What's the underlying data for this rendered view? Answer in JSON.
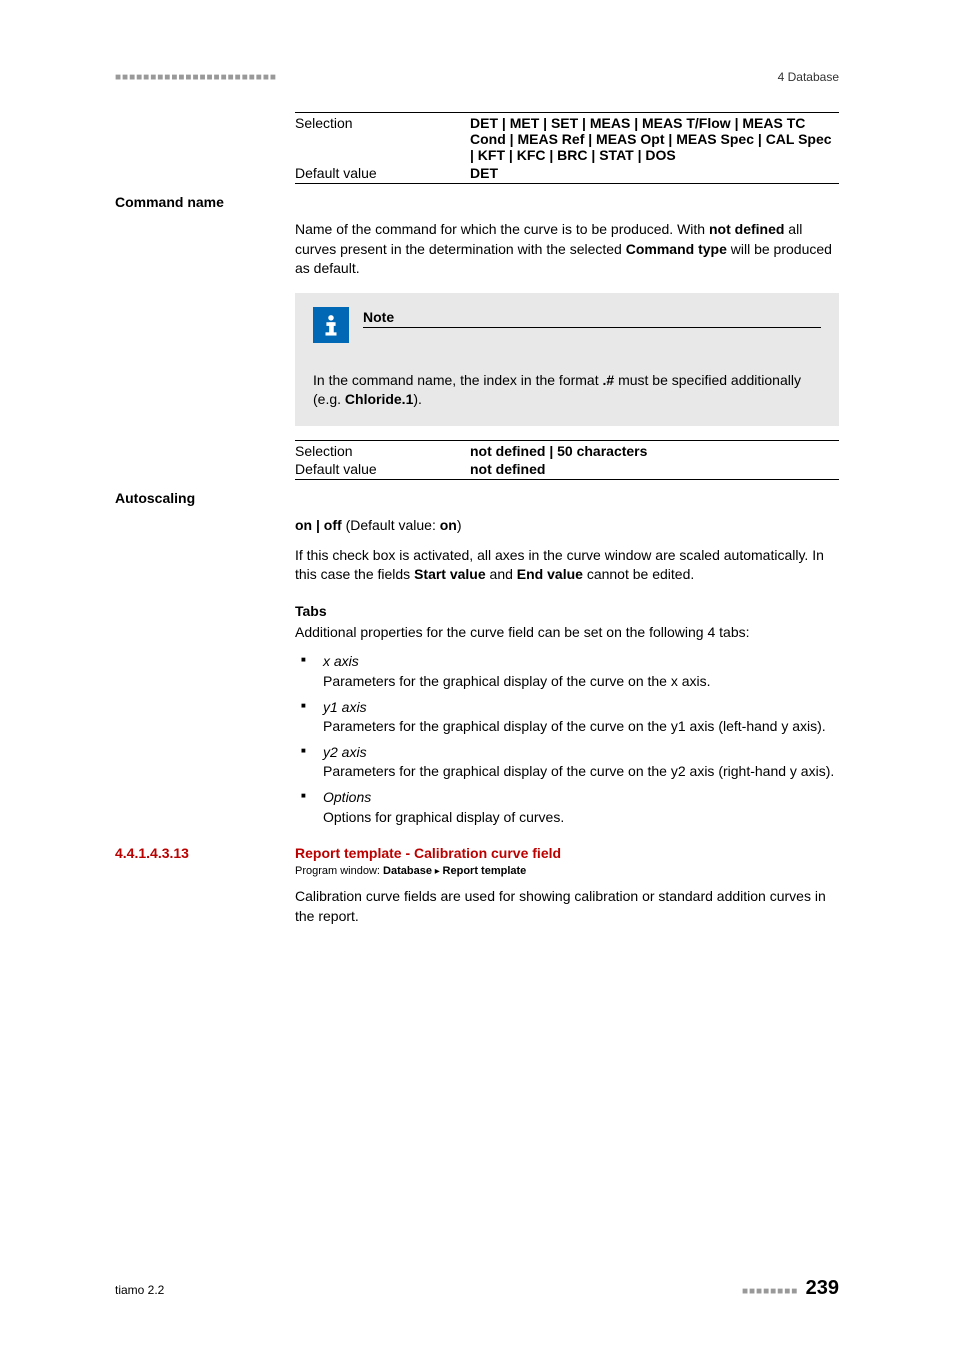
{
  "header": {
    "left_marker": "■■■■■■■■■■■■■■■■■■■■■■■",
    "right": "4 Database"
  },
  "command_type": {
    "selection_label": "Selection",
    "selection_value": "DET | MET | SET | MEAS | MEAS T/Flow | MEAS TC Cond | MEAS Ref | MEAS Opt | MEAS Spec | CAL Spec | KFT | KFC | BRC | STAT | DOS",
    "default_label": "Default value",
    "default_value": "DET"
  },
  "command_name": {
    "heading": "Command name",
    "description_pre": "Name of the command for which the curve is to be produced. With ",
    "description_bold1": "not defined",
    "description_mid": " all curves present in the determination with the selected ",
    "description_bold2": "Command type",
    "description_post": " will be produced as default.",
    "note": {
      "title": "Note",
      "body_pre": "In the command name, the index in the format ",
      "body_bold1": ".#",
      "body_mid": " must be specified additionally (e.g. ",
      "body_bold2": "Chloride.1",
      "body_post": ")."
    },
    "selection_label": "Selection",
    "selection_value": "not defined | 50 characters",
    "default_label": "Default value",
    "default_value": "not defined"
  },
  "autoscaling": {
    "heading": "Autoscaling",
    "onoff_pre": "on | off",
    "onoff_mid": " (Default value: ",
    "onoff_bold": "on",
    "onoff_post": ")",
    "desc_pre": "If this check box is activated, all axes in the curve window are scaled automatically. In this case the fields ",
    "desc_bold1": "Start value",
    "desc_mid": " and ",
    "desc_bold2": "End value",
    "desc_post": " cannot be edited."
  },
  "tabs": {
    "heading": "Tabs",
    "intro": "Additional properties for the curve field can be set on the following 4 tabs:",
    "items": [
      {
        "title": "x axis",
        "desc": "Parameters for the graphical display of the curve on the x axis."
      },
      {
        "title": "y1 axis",
        "desc": "Parameters for the graphical display of the curve on the y1 axis (left-hand y axis)."
      },
      {
        "title": "y2 axis",
        "desc": "Parameters for the graphical display of the curve on the y2 axis (right-hand y axis)."
      },
      {
        "title": "Options",
        "desc": "Options for graphical display of curves."
      }
    ]
  },
  "section": {
    "number": "4.4.1.4.3.13",
    "title": "Report template - Calibration curve field",
    "program_window_label": "Program window: ",
    "program_window_bold1": "Database",
    "program_window_sep": " ▸ ",
    "program_window_bold2": "Report template",
    "body": "Calibration curve fields are used for showing calibration or standard addition curves in the report."
  },
  "footer": {
    "left": "tiamo 2.2",
    "right_marker": "■■■■■■■■",
    "page": "239"
  }
}
